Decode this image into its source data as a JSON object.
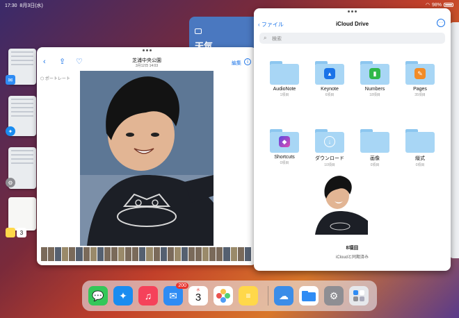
{
  "status_bar": {
    "time": "17:30",
    "date": "8月3日(水)",
    "battery": "98%"
  },
  "weather_card": {
    "label": "天気"
  },
  "photos_window": {
    "title": "芝浦中央公園",
    "subtitle": "3月12日 14:03",
    "edit_label": "編集",
    "portrait_label": "ポートレート"
  },
  "files_window": {
    "back_label": "ファイル",
    "title": "iCloud Drive",
    "search_placeholder": "検索",
    "folders": [
      {
        "name": "AudioNote",
        "count": "1項目"
      },
      {
        "name": "Keynote",
        "count": "6項目"
      },
      {
        "name": "Numbers",
        "count": "18項目"
      },
      {
        "name": "Pages",
        "count": "35項目"
      },
      {
        "name": "Shortcuts",
        "count": "0項目"
      },
      {
        "name": "ダウンロード",
        "count": "10項目"
      },
      {
        "name": "画像",
        "count": "0項目"
      },
      {
        "name": "縦式",
        "count": "0項目"
      }
    ],
    "item_count": "8項目",
    "sync_status": "iCloudと同期済み"
  },
  "dock": {
    "apps": [
      {
        "name": "Messages",
        "icon": "message-icon",
        "color": "#34c759"
      },
      {
        "name": "Safari",
        "icon": "compass-icon",
        "color": "#1a8cf0"
      },
      {
        "name": "Music",
        "icon": "music-icon",
        "color": "#f5425a"
      },
      {
        "name": "Mail",
        "icon": "mail-icon",
        "color": "#2f8cf4",
        "badge": "200"
      },
      {
        "name": "Calendar",
        "icon": "calendar-icon",
        "color": "#ffffff",
        "day_label": "水",
        "day": "3"
      },
      {
        "name": "Photos",
        "icon": "photos-icon",
        "color": "#ffffff"
      },
      {
        "name": "Notes",
        "icon": "notes-icon",
        "color": "#ffd84a"
      },
      {
        "name": "Weather",
        "icon": "weather-icon",
        "color": "#3b8de8"
      },
      {
        "name": "Files",
        "icon": "folder-icon",
        "color": "#ffffff"
      },
      {
        "name": "Settings",
        "icon": "gear-icon",
        "color": "#8e8e93"
      },
      {
        "name": "App Library",
        "icon": "app-library-icon",
        "color": "#e6e8ec"
      }
    ]
  },
  "left_thumbs": {
    "calendar_day": "3"
  }
}
